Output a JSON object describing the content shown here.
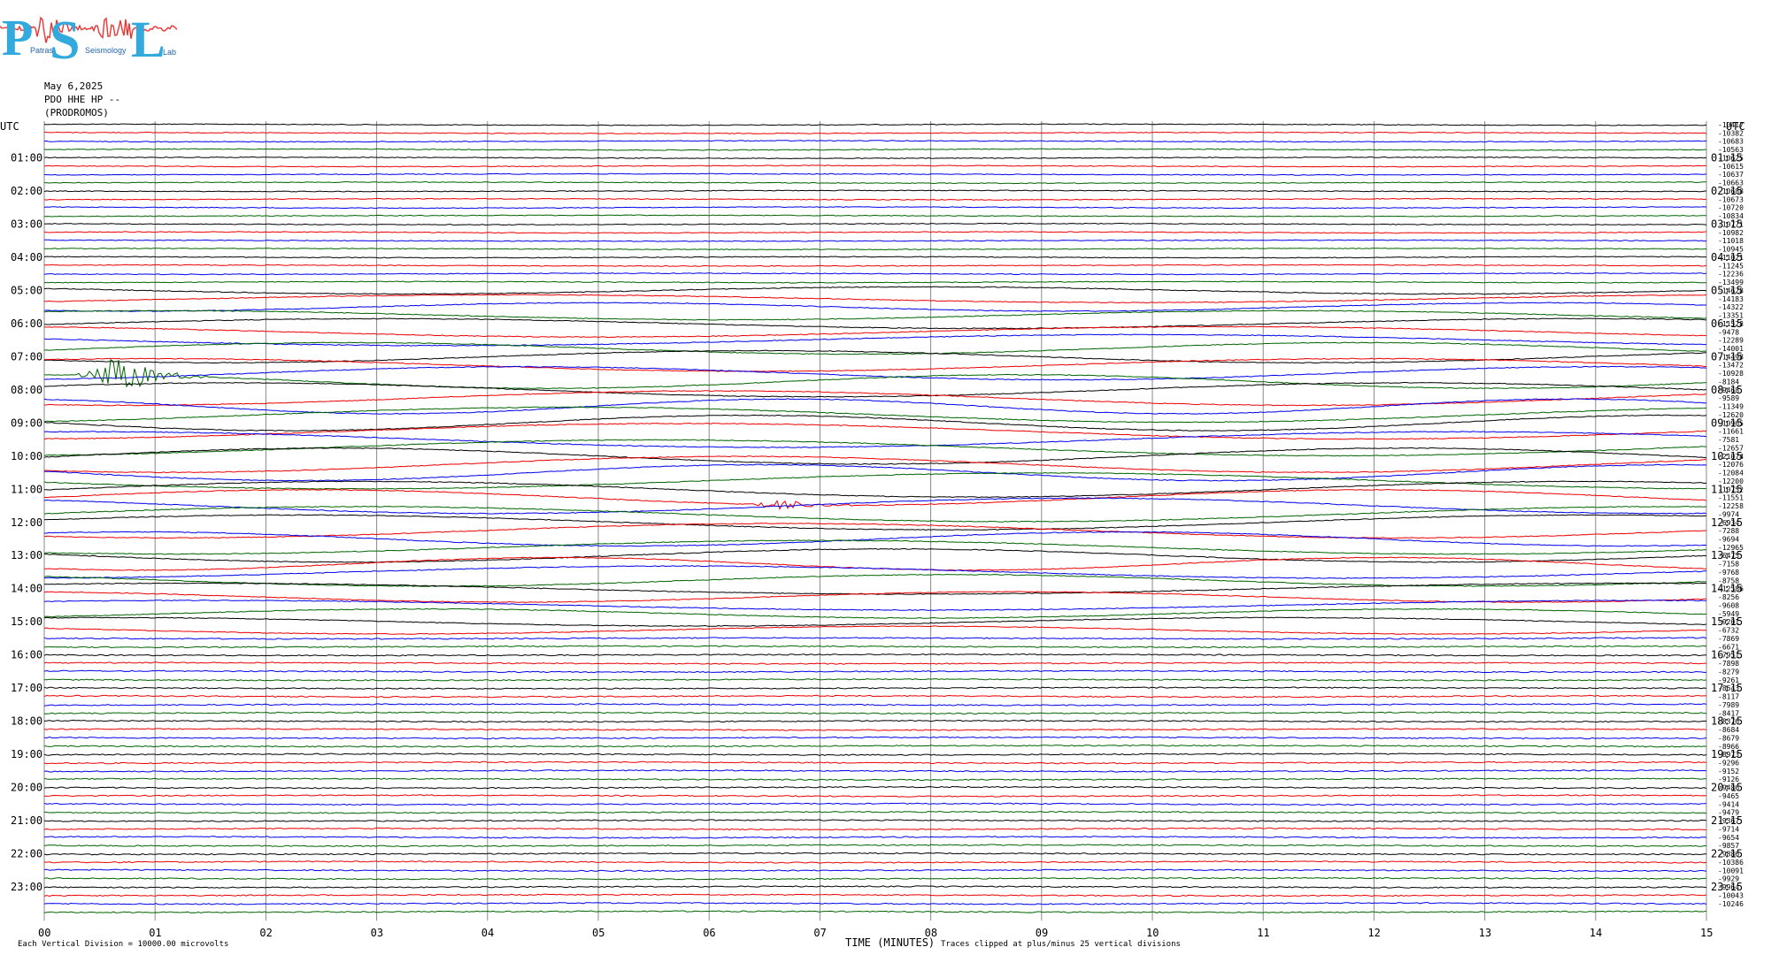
{
  "logo": {
    "letters": [
      "P",
      "S",
      "L"
    ],
    "words": [
      "Patras",
      "Seismology",
      "Lab"
    ]
  },
  "header": {
    "date": "May 6,2025",
    "channel": "PDO HHE HP --",
    "station": "(PRODROMOS)"
  },
  "left_axis_label": "UTC",
  "right_axis_label": "UTC",
  "footer": {
    "division_note": "Each Vertical Division = 10000.00 microvolts",
    "x_title": "TIME (MINUTES)",
    "clip_note": "Traces clipped at plus/minus 25 vertical divisions"
  },
  "colors": {
    "cycle": [
      "#000000",
      "#ee0000",
      "#0000ee",
      "#006400"
    ],
    "grid": "#888888"
  },
  "chart_data": {
    "type": "line",
    "title": "",
    "xlabel": "TIME (MINUTES)",
    "ylabel": "UTC",
    "xlim": [
      0,
      15
    ],
    "x_ticks": [
      "00",
      "01",
      "02",
      "03",
      "04",
      "05",
      "06",
      "07",
      "08",
      "09",
      "10",
      "11",
      "12",
      "13",
      "14",
      "15"
    ],
    "left_hour_labels": [
      "01:00",
      "02:00",
      "03:00",
      "04:00",
      "05:00",
      "06:00",
      "07:00",
      "08:00",
      "09:00",
      "10:00",
      "11:00",
      "12:00",
      "13:00",
      "14:00",
      "15:00",
      "16:00",
      "17:00",
      "18:00",
      "19:00",
      "20:00",
      "21:00",
      "22:00",
      "23:00"
    ],
    "right_hour_labels": [
      "01:15",
      "02:15",
      "03:15",
      "04:15",
      "05:15",
      "06:15",
      "07:15",
      "08:15",
      "09:15",
      "10:15",
      "11:15",
      "12:15",
      "13:15",
      "14:15",
      "15:15",
      "16:15",
      "17:15",
      "18:15",
      "19:15",
      "20:15",
      "21:15",
      "22:15",
      "23:15"
    ],
    "trace_count": 96,
    "trace_minutes": 15,
    "trace_offsets": [
      -10417,
      -10382,
      -10683,
      -10563,
      -10625,
      -10615,
      -10637,
      -10663,
      -10688,
      -10673,
      -10720,
      -10834,
      -10771,
      -10982,
      -11018,
      -10945,
      -11021,
      -11245,
      -12236,
      -13499,
      -14628,
      -14183,
      -14322,
      -13351,
      -11528,
      -9478,
      -12289,
      -14001,
      -14498,
      -13472,
      -10928,
      -8184,
      -9468,
      -9589,
      -11349,
      -12620,
      -10965,
      -11661,
      -7581,
      -12657,
      -21074,
      -12076,
      -12084,
      -12200,
      -10752,
      -11551,
      -12258,
      -9974,
      -6934,
      -7288,
      -9694,
      -12965,
      -6475,
      -7158,
      -9768,
      -8758,
      -12586,
      -8256,
      -9608,
      -5949,
      -9201,
      -6732,
      -7869,
      -6671,
      -7951,
      -7898,
      -8279,
      -9261,
      -8643,
      -8117,
      -7989,
      -8417,
      -8376,
      -8684,
      -8679,
      -8966,
      -8973,
      -9296,
      -9152,
      -9126,
      -9486,
      -9465,
      -9414,
      -9479,
      -9367,
      -9714,
      -9654,
      -9857,
      -9886,
      -10386,
      -10091,
      -9929,
      -9964,
      -10043,
      -10246
    ],
    "events": [
      {
        "trace": 31,
        "minute": 0.65,
        "peak_divisions": 2.5,
        "label": ""
      },
      {
        "trace": 45,
        "minute": 6.65,
        "peak_divisions": 0.6,
        "label": ""
      }
    ],
    "grid": true
  }
}
